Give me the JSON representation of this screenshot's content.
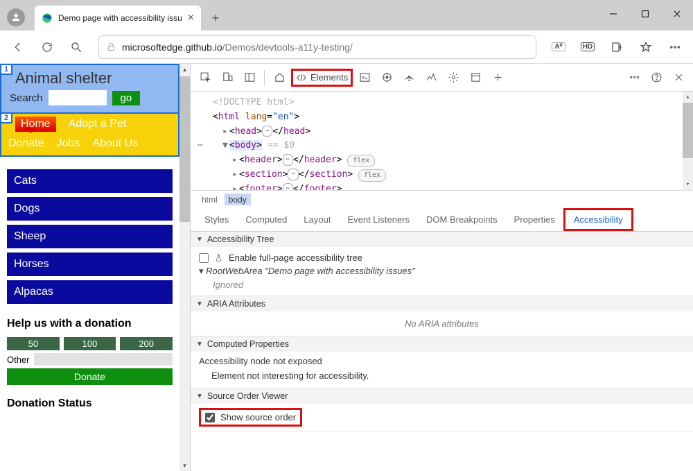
{
  "browser": {
    "tab_title": "Demo page with accessibility issu",
    "url_host": "microsoftedge.github.io",
    "url_path": "/Demos/devtools-a11y-testing/",
    "aa_chip": "A⁰",
    "hd_chip": "HD"
  },
  "page": {
    "badge1": "1",
    "badge2": "2",
    "title": "Animal shelter",
    "search_label": "Search",
    "go": "go",
    "nav": [
      "Home",
      "Adopt a Pet",
      "Donate",
      "Jobs",
      "About Us"
    ],
    "side": [
      "Cats",
      "Dogs",
      "Sheep",
      "Horses",
      "Alpacas"
    ],
    "donation_heading": "Help us with a donation",
    "amounts": [
      "50",
      "100",
      "200"
    ],
    "other_label": "Other",
    "donate_btn": "Donate",
    "status_heading": "Donation Status"
  },
  "devtools": {
    "elements_label": "Elements",
    "dom": {
      "doctype": "<!DOCTYPE html>",
      "html_open": "html",
      "lang_attr": "lang",
      "lang_val": "\"en\"",
      "head": "head",
      "body": "body",
      "body_suffix": " == $0",
      "header": "header",
      "section": "section",
      "footer": "footer",
      "flex": "flex"
    },
    "crumbs": [
      "html",
      "body"
    ],
    "panel_tabs": [
      "Styles",
      "Computed",
      "Layout",
      "Event Listeners",
      "DOM Breakpoints",
      "Properties",
      "Accessibility"
    ],
    "a11y": {
      "tree_hdr": "Accessibility Tree",
      "enable_full": "Enable full-page accessibility tree",
      "root_label": "RootWebArea \"Demo page with accessibility issues\"",
      "ignored": "Ignored",
      "aria_hdr": "ARIA Attributes",
      "no_aria": "No ARIA attributes",
      "computed_hdr": "Computed Properties",
      "not_exposed": "Accessibility node not exposed",
      "not_interesting": "Element not interesting for accessibility.",
      "src_order_hdr": "Source Order Viewer",
      "show_src_order": "Show source order"
    }
  }
}
